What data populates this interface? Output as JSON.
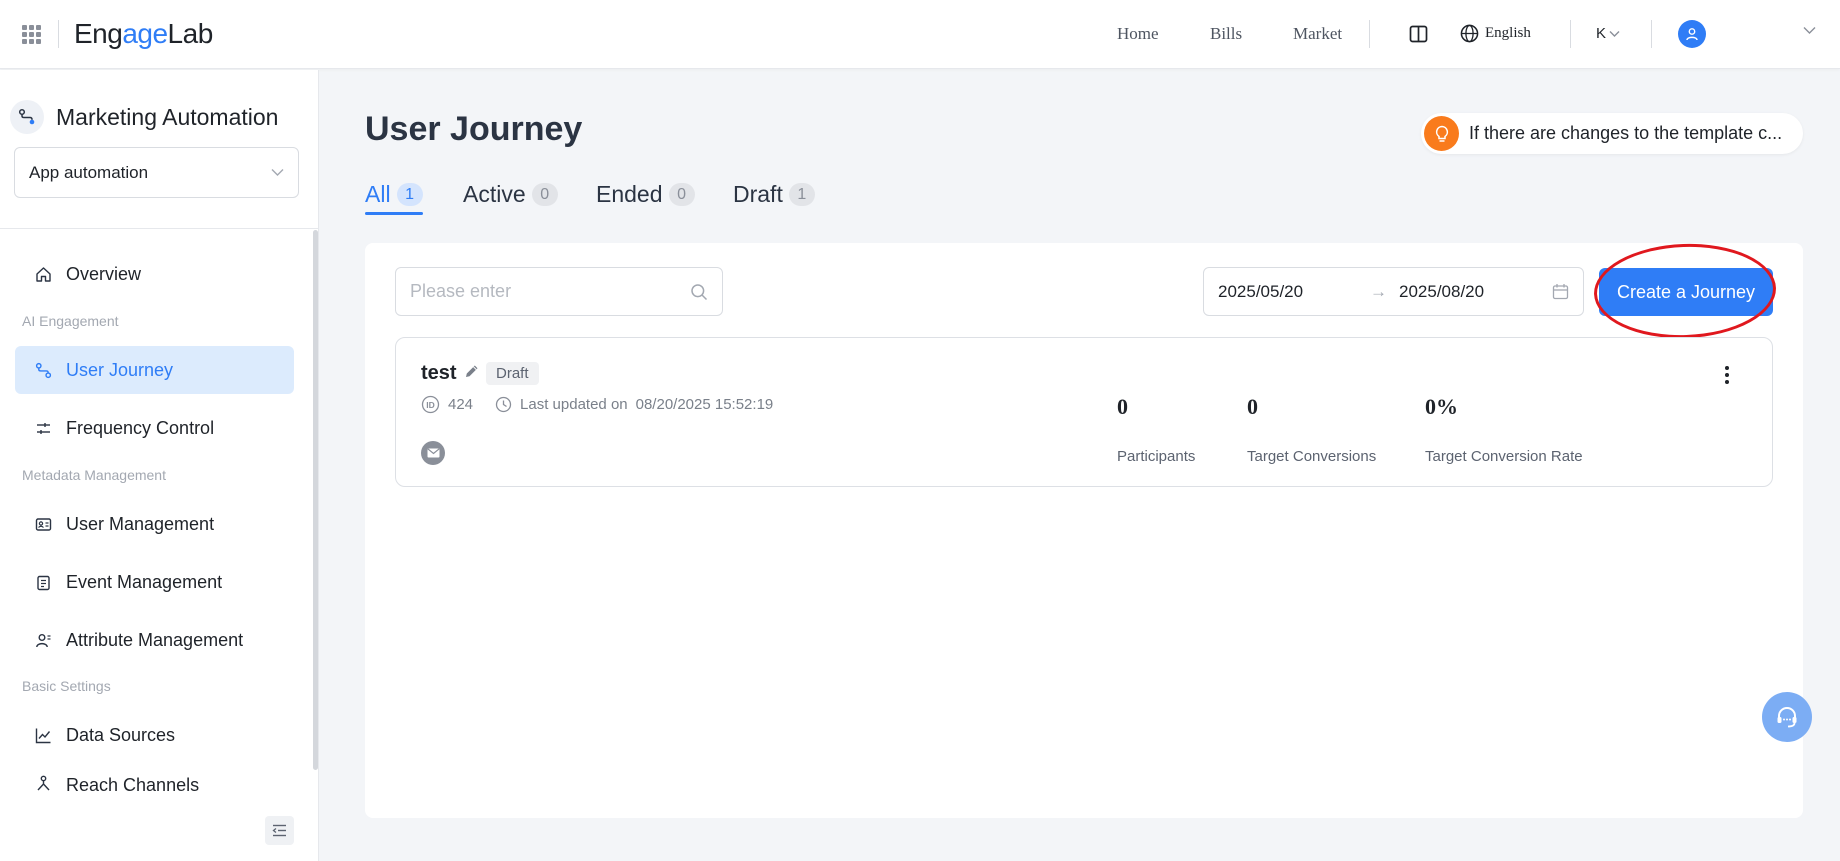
{
  "header": {
    "logo_prefix": "Eng",
    "logo_accent": "age",
    "logo_suffix": "Lab",
    "nav": [
      "Home",
      "Bills",
      "Market"
    ],
    "language": "English",
    "user_initial": "K"
  },
  "sidebar": {
    "module_title": "Marketing Automation",
    "app_select": "App automation",
    "items": [
      {
        "label": "Overview"
      },
      {
        "group": "AI Engagement"
      },
      {
        "label": "User Journey",
        "active": true
      },
      {
        "label": "Frequency Control"
      },
      {
        "group": "Metadata Management"
      },
      {
        "label": "User Management"
      },
      {
        "label": "Event Management"
      },
      {
        "label": "Attribute Management"
      },
      {
        "group": "Basic Settings"
      },
      {
        "label": "Data Sources"
      },
      {
        "label": "Reach Channels"
      }
    ]
  },
  "main": {
    "title": "User Journey",
    "notice": "If there are changes to the template c...",
    "tabs": [
      {
        "label": "All",
        "count": "1",
        "active": true
      },
      {
        "label": "Active",
        "count": "0"
      },
      {
        "label": "Ended",
        "count": "0"
      },
      {
        "label": "Draft",
        "count": "1"
      }
    ],
    "search_placeholder": "Please enter",
    "date_start": "2025/05/20",
    "date_arrow": "→",
    "date_end": "2025/08/20",
    "create_label": "Create a Journey",
    "journey": {
      "name": "test",
      "status": "Draft",
      "id": "424",
      "updated_label": "Last updated on",
      "updated_at": "08/20/2025 15:52:19",
      "stats": [
        {
          "value": "0",
          "label": "Participants"
        },
        {
          "value": "0",
          "label": "Target Conversions"
        },
        {
          "value": "0%",
          "label": "Target Conversion Rate"
        }
      ]
    }
  },
  "colors": {
    "accent": "#2f7df6",
    "notice": "#f97b1c",
    "highlight_circle": "#e0181e"
  }
}
